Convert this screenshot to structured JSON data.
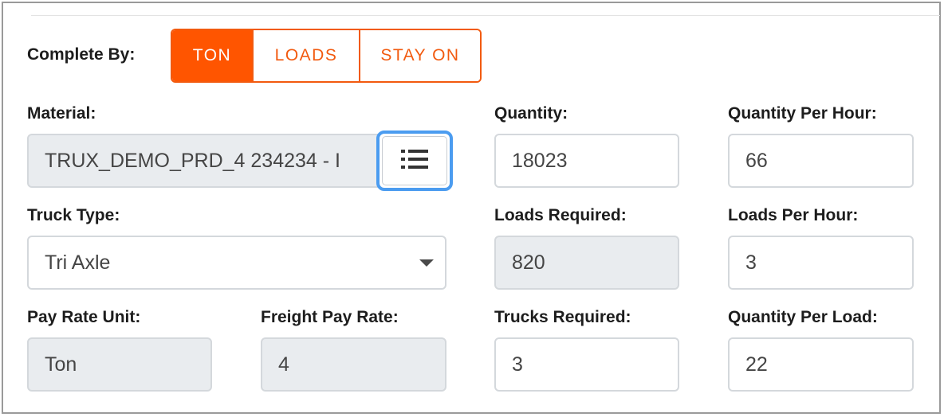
{
  "complete_by": {
    "label": "Complete By:",
    "options": [
      "TON",
      "LOADS",
      "STAY ON"
    ],
    "selected": "TON"
  },
  "material": {
    "label": "Material:",
    "value": "TRUX_DEMO_PRD_4 234234 - I"
  },
  "quantity": {
    "label": "Quantity:",
    "value": "18023"
  },
  "quantity_per_hour": {
    "label": "Quantity Per Hour:",
    "value": "66"
  },
  "truck_type": {
    "label": "Truck Type:",
    "value": "Tri Axle"
  },
  "loads_required": {
    "label": "Loads Required:",
    "value": "820"
  },
  "loads_per_hour": {
    "label": "Loads Per Hour:",
    "value": "3"
  },
  "pay_rate_unit": {
    "label": "Pay Rate Unit:",
    "value": "Ton"
  },
  "freight_pay_rate": {
    "label": "Freight Pay Rate:",
    "value": "4"
  },
  "trucks_required": {
    "label": "Trucks Required:",
    "value": "3"
  },
  "quantity_per_load": {
    "label": "Quantity Per Load:",
    "value": "22"
  },
  "icons": {
    "material_list_button": "list-icon",
    "truck_type_dropdown": "caret-down-icon"
  },
  "colors": {
    "accent": "#ff5500",
    "focus_ring": "#4b9cf0",
    "readonly_bg": "#e9ecef"
  }
}
